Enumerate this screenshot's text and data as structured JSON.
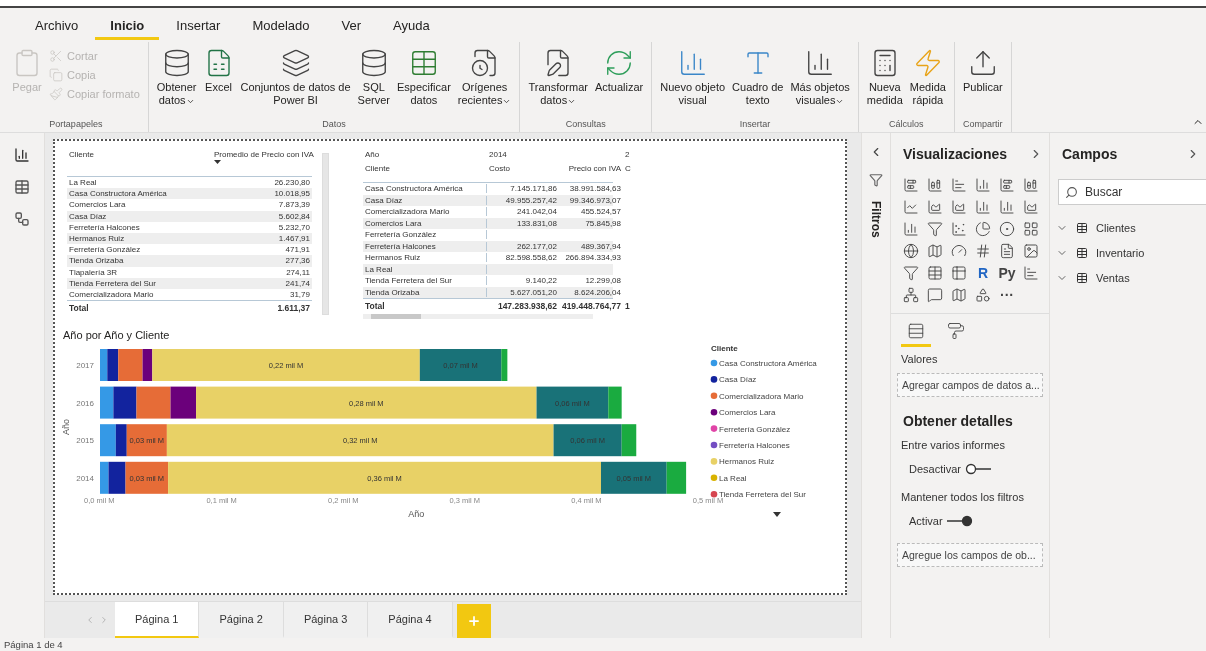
{
  "ribbon": {
    "tabs": [
      {
        "label": "Archivo",
        "selected": false
      },
      {
        "label": "Inicio",
        "selected": true
      },
      {
        "label": "Insertar",
        "selected": false
      },
      {
        "label": "Modelado",
        "selected": false
      },
      {
        "label": "Ver",
        "selected": false
      },
      {
        "label": "Ayuda",
        "selected": false
      }
    ],
    "groups": [
      {
        "label": "Portapapeles",
        "buttons": [
          {
            "kind": "large",
            "label": "Pegar",
            "disabled": true,
            "dropdown": false
          },
          {
            "kind": "small",
            "label": "Cortar",
            "disabled": true,
            "dropdown": false
          },
          {
            "kind": "small",
            "label": "Copia",
            "disabled": true,
            "dropdown": false
          },
          {
            "kind": "small",
            "label": "Copiar formato",
            "disabled": true,
            "dropdown": false
          }
        ]
      },
      {
        "label": "Datos",
        "buttons": [
          {
            "kind": "large",
            "label": "Obtener\ndatos",
            "disabled": false,
            "dropdown": true
          },
          {
            "kind": "large",
            "label": "Excel",
            "disabled": false,
            "dropdown": false
          },
          {
            "kind": "large",
            "label": "Conjuntos de datos de\nPower BI",
            "disabled": false,
            "dropdown": false
          },
          {
            "kind": "large",
            "label": "SQL\nServer",
            "disabled": false,
            "dropdown": false
          },
          {
            "kind": "large",
            "label": "Especificar\ndatos",
            "disabled": false,
            "dropdown": false
          },
          {
            "kind": "large",
            "label": "Orígenes\nrecientes",
            "disabled": false,
            "dropdown": true
          }
        ]
      },
      {
        "label": "Consultas",
        "buttons": [
          {
            "kind": "large",
            "label": "Transformar\ndatos",
            "disabled": false,
            "dropdown": true
          },
          {
            "kind": "large",
            "label": "Actualizar",
            "disabled": false,
            "dropdown": false
          }
        ]
      },
      {
        "label": "Insertar",
        "buttons": [
          {
            "kind": "large",
            "label": "Nuevo objeto\nvisual",
            "disabled": false,
            "dropdown": false
          },
          {
            "kind": "large",
            "label": "Cuadro de\ntexto",
            "disabled": false,
            "dropdown": false
          },
          {
            "kind": "large",
            "label": "Más objetos\nvisuales",
            "disabled": false,
            "dropdown": true
          }
        ]
      },
      {
        "label": "Cálculos",
        "buttons": [
          {
            "kind": "large",
            "label": "Nueva\nmedida",
            "disabled": false,
            "dropdown": false
          },
          {
            "kind": "large",
            "label": "Medida\nrápida",
            "disabled": false,
            "dropdown": false
          }
        ]
      },
      {
        "label": "Compartir",
        "buttons": [
          {
            "kind": "large",
            "label": "Publicar",
            "disabled": false,
            "dropdown": false
          }
        ]
      }
    ]
  },
  "table_1": {
    "columns": [
      "Cliente",
      "Promedio de Precio con IVA"
    ],
    "rows": [
      [
        "La Real",
        "26.230,80"
      ],
      [
        "Casa Constructora América",
        "10.018,95"
      ],
      [
        "Comercios Lara",
        "7.873,39"
      ],
      [
        "Casa Díaz",
        "5.602,84"
      ],
      [
        "Ferretería Halcones",
        "5.232,70"
      ],
      [
        "Hermanos Ruiz",
        "1.467,91"
      ],
      [
        "Ferretería González",
        "471,91"
      ],
      [
        "Tienda Orizaba",
        "277,36"
      ],
      [
        "Tlapalería 3R",
        "274,11"
      ],
      [
        "Tienda Ferretera del Sur",
        "241,74"
      ],
      [
        "Comercializadora Mario",
        "31,79"
      ]
    ],
    "total": [
      "Total",
      "1.611,37"
    ]
  },
  "table_2": {
    "header_1": [
      "Año",
      "2014",
      "2"
    ],
    "header_2": [
      "Cliente",
      "Costo",
      "Precio con IVA",
      "C"
    ],
    "rows": [
      [
        "Casa Constructora América",
        "7.145.171,86",
        "38.991.584,63"
      ],
      [
        "Casa Díaz",
        "49.955.257,42",
        "99.346.973,07"
      ],
      [
        "Comercializadora Mario",
        "241.042,04",
        "455.524,57"
      ],
      [
        "Comercios Lara",
        "133.831,08",
        "75.845,98"
      ],
      [
        "Ferretería González",
        "",
        ""
      ],
      [
        "Ferretería Halcones",
        "262.177,02",
        "489.367,94"
      ],
      [
        "Hermanos Ruiz",
        "82.598.558,62",
        "266.894.334,93"
      ],
      [
        "La Real",
        "",
        ""
      ],
      [
        "Tienda Ferretera del Sur",
        "9.140,22",
        "12.299,08"
      ],
      [
        "Tienda Orizaba",
        "5.627.051,20",
        "8.624.206,04"
      ]
    ],
    "total": [
      "Total",
      "147.283.938,62",
      "419.448.764,77",
      "1"
    ]
  },
  "chart": {
    "title": "Año por Año y Cliente",
    "legend_title": "Cliente",
    "chart_data": {
      "type": "bar",
      "orientation": "horizontal",
      "stacked": true,
      "legend": "right",
      "xlabel": "Año",
      "ylabel": "Año",
      "categories": [
        "2017",
        "2016",
        "2015",
        "2014"
      ],
      "xlim": [
        0,
        0.5
      ],
      "xticks": [
        {
          "value": 0,
          "label": "0,0 mil M"
        },
        {
          "value": 0.1,
          "label": "0,1 mil M"
        },
        {
          "value": 0.2,
          "label": "0,2 mil M"
        },
        {
          "value": 0.3,
          "label": "0,3 mil M"
        },
        {
          "value": 0.4,
          "label": "0,4 mil M"
        },
        {
          "value": 0.5,
          "label": "0,5 mil M"
        }
      ],
      "series": [
        {
          "name": "Casa Constructora América",
          "color": "#3599e6",
          "values": [
            0.006,
            0.011,
            0.013,
            0.007
          ],
          "value_labels": [
            null,
            null,
            null,
            null
          ]
        },
        {
          "name": "Casa Díaz",
          "color": "#12239e",
          "values": [
            0.009,
            0.019,
            0.009,
            0.014
          ],
          "value_labels": [
            null,
            null,
            null,
            null
          ]
        },
        {
          "name": "Comercializadora Mario",
          "color": "#e66c37",
          "values": [
            0.02,
            0.028,
            0.033,
            0.035
          ],
          "value_labels": [
            null,
            null,
            "0,03 mil M",
            "0,03 mil M"
          ]
        },
        {
          "name": "Comercios Lara",
          "color": "#6b007b",
          "values": [
            0.008,
            0.021,
            0,
            0
          ],
          "value_labels": [
            null,
            null,
            null,
            null
          ]
        },
        {
          "name": "Ferretería González",
          "color": "#e044a7",
          "values": [
            0,
            0,
            0,
            0
          ],
          "value_labels": [
            null,
            null,
            null,
            null
          ]
        },
        {
          "name": "Ferretería Halcones",
          "color": "#744ec2",
          "values": [
            0,
            0,
            0,
            0
          ],
          "value_labels": [
            null,
            null,
            null,
            null
          ]
        },
        {
          "name": "Hermanos Ruiz",
          "color": "#e8d166",
          "values": [
            0.22,
            0.28,
            0.318,
            0.356
          ],
          "value_labels": [
            "0,22 mil M",
            "0,28 mil M",
            "0,32 mil M",
            "0,36 mil M"
          ]
        },
        {
          "name": "La Real",
          "color": "#d9b300",
          "values": [
            0,
            0,
            0,
            0
          ],
          "value_labels": [
            null,
            null,
            null,
            null
          ]
        },
        {
          "name": "Tienda Ferretera del Sur",
          "color": "#d64550",
          "values": [
            0,
            0,
            0,
            0
          ],
          "value_labels": [
            null,
            null,
            null,
            null
          ]
        },
        {
          "color": "#197278",
          "values": [
            0.067,
            0.059,
            0.056,
            0.054
          ],
          "value_labels": [
            "0,07 mil M",
            "0,06 mil M",
            "0,06 mil M",
            "0,05 mil M"
          ]
        },
        {
          "color": "#1aab40",
          "values": [
            0.005,
            0.011,
            0.012,
            0.016
          ],
          "value_labels": [
            null,
            null,
            null,
            null
          ]
        }
      ]
    }
  },
  "filters": {
    "label": "Filtros"
  },
  "visualizations": {
    "title": "Visualizaciones",
    "icons": [
      {
        "kind": "icon"
      },
      {
        "kind": "icon"
      },
      {
        "kind": "icon"
      },
      {
        "kind": "icon"
      },
      {
        "kind": "icon"
      },
      {
        "kind": "icon"
      },
      {
        "kind": "icon"
      },
      {
        "kind": "icon"
      },
      {
        "kind": "icon"
      },
      {
        "kind": "icon"
      },
      {
        "kind": "icon"
      },
      {
        "kind": "icon"
      },
      {
        "kind": "icon"
      },
      {
        "kind": "icon"
      },
      {
        "kind": "icon"
      },
      {
        "kind": "icon"
      },
      {
        "kind": "icon"
      },
      {
        "kind": "icon"
      },
      {
        "kind": "icon"
      },
      {
        "kind": "icon"
      },
      {
        "kind": "icon"
      },
      {
        "kind": "icon"
      },
      {
        "kind": "icon"
      },
      {
        "kind": "icon"
      },
      {
        "kind": "icon"
      },
      {
        "kind": "icon"
      },
      {
        "kind": "icon"
      },
      {
        "kind": "text",
        "label": "R"
      },
      {
        "kind": "text",
        "label": "Py"
      },
      {
        "kind": "icon"
      },
      {
        "kind": "icon"
      },
      {
        "kind": "icon"
      },
      {
        "kind": "icon"
      },
      {
        "kind": "icon"
      },
      {
        "kind": "text",
        "label": "···"
      }
    ],
    "pane_tabs": [
      {
        "selected": true
      },
      {
        "selected": false
      }
    ],
    "values_label": "Valores",
    "values_placeholder": "Agregar campos de datos a...",
    "drill_title": "Obtener detalles",
    "cross_report": {
      "label": "Entre varios informes",
      "toggle_label": "Desactivar",
      "on": false
    },
    "keep_filters": {
      "label": "Mantener todos los filtros",
      "toggle_label": "Activar",
      "on": true
    },
    "drill_placeholder": "Agregue los campos de ob..."
  },
  "fields": {
    "title": "Campos",
    "search": {
      "placeholder": "Buscar"
    },
    "tables": [
      {
        "label": "Clientes",
        "expanded": false
      },
      {
        "label": "Inventario",
        "expanded": false
      },
      {
        "label": "Ventas",
        "expanded": false
      }
    ]
  },
  "pages": [
    {
      "label": "Página 1",
      "selected": true
    },
    {
      "label": "Página 2",
      "selected": false
    },
    {
      "label": "Página 3",
      "selected": false
    },
    {
      "label": "Página 4",
      "selected": false
    }
  ],
  "status_bar": "Página 1 de 4"
}
